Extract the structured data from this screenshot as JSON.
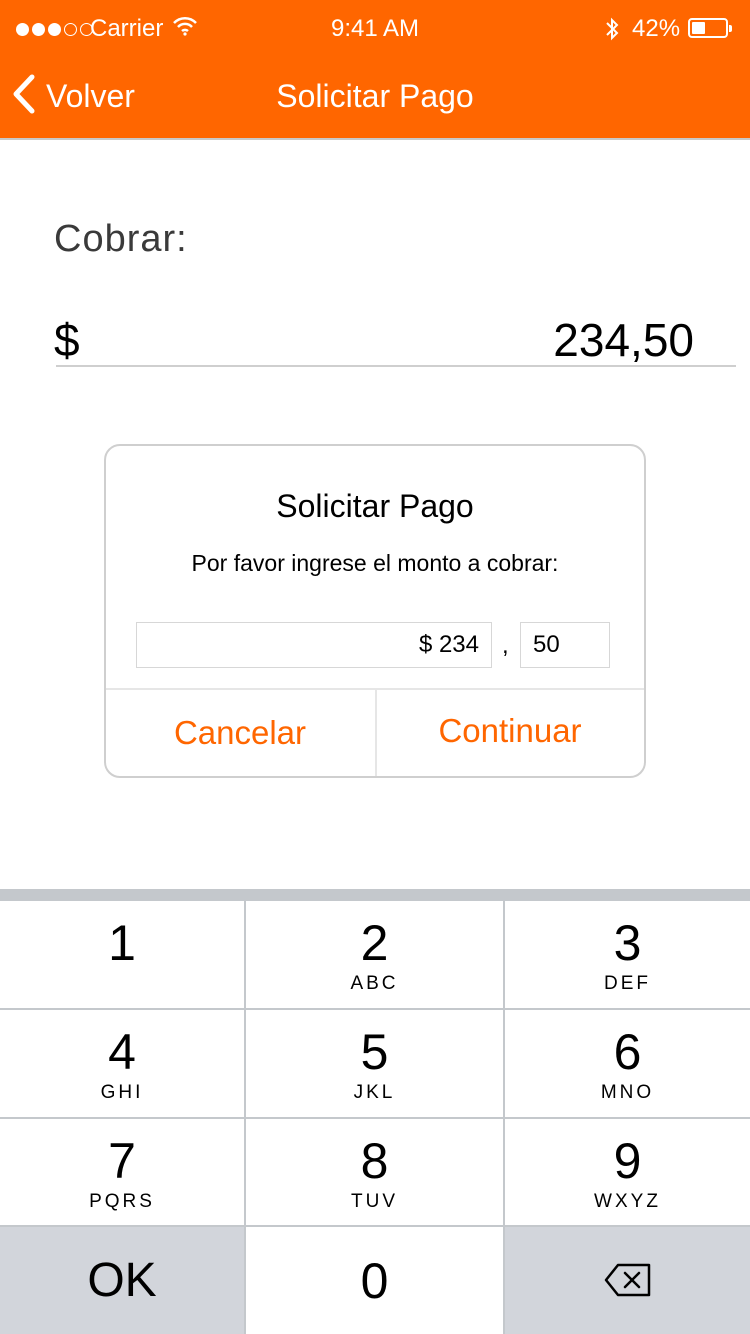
{
  "status_bar": {
    "carrier": "Carrier",
    "time": "9:41 AM",
    "battery_percent": "42%",
    "battery_level": 0.42,
    "signal_bars_filled": 3,
    "signal_bars_total": 5
  },
  "nav": {
    "back_label": "Volver",
    "title": "Solicitar Pago",
    "color": "#ff6600"
  },
  "main": {
    "charge_label": "Cobrar:",
    "currency_symbol": "$",
    "amount": "234,50"
  },
  "dialog": {
    "title": "Solicitar Pago",
    "message": "Por favor ingrese el monto a cobrar:",
    "integer_value": "$ 234",
    "separator": ",",
    "decimal_value": "50",
    "cancel_label": "Cancelar",
    "continue_label": "Continuar",
    "accent": "#ff6600"
  },
  "keypad": {
    "keys": [
      {
        "num": "1",
        "letters": ""
      },
      {
        "num": "2",
        "letters": "ABC"
      },
      {
        "num": "3",
        "letters": "DEF"
      },
      {
        "num": "4",
        "letters": "GHI"
      },
      {
        "num": "5",
        "letters": "JKL"
      },
      {
        "num": "6",
        "letters": "MNO"
      },
      {
        "num": "7",
        "letters": "PQRS"
      },
      {
        "num": "8",
        "letters": "TUV"
      },
      {
        "num": "9",
        "letters": "WXYZ"
      }
    ],
    "ok_label": "OK",
    "zero": "0",
    "delete_icon": "backspace-icon"
  }
}
